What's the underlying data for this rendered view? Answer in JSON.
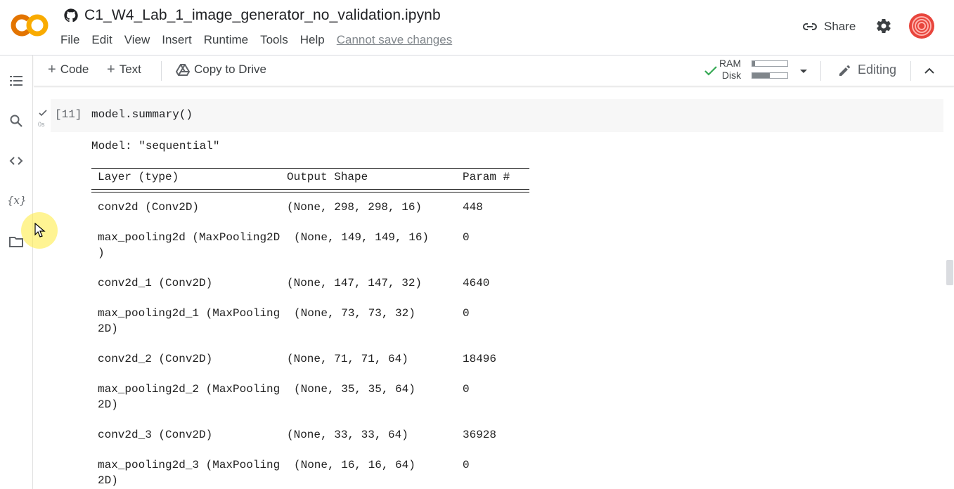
{
  "header": {
    "notebook_title": "C1_W4_Lab_1_image_generator_no_validation.ipynb",
    "logo_text": "CO",
    "menu": [
      "File",
      "Edit",
      "View",
      "Insert",
      "Runtime",
      "Tools",
      "Help"
    ],
    "save_status": "Cannot save changes",
    "share_label": "Share"
  },
  "toolbar": {
    "code_label": "Code",
    "text_label": "Text",
    "copy_drive_label": "Copy to Drive",
    "ram_label": "RAM",
    "disk_label": "Disk",
    "ram_usage": 0.08,
    "disk_usage": 0.5,
    "editing_label": "Editing"
  },
  "cell": {
    "exec_count": "[11]",
    "code": "model.summary()",
    "time": "0s"
  },
  "output": {
    "model_line": "Model: \"sequential\"",
    "headers": {
      "layer": "Layer (type)",
      "shape": "Output Shape",
      "params": "Param #"
    },
    "rows": [
      {
        "layer": "conv2d (Conv2D)",
        "layer2": "",
        "shape": "(None, 298, 298, 16)",
        "params": "448"
      },
      {
        "layer": "max_pooling2d (MaxPooling2D",
        "layer2": ")",
        "shape": "(None, 149, 149, 16)",
        "params": "0"
      },
      {
        "layer": "conv2d_1 (Conv2D)",
        "layer2": "",
        "shape": "(None, 147, 147, 32)",
        "params": "4640"
      },
      {
        "layer": "max_pooling2d_1 (MaxPooling",
        "layer2": "2D)",
        "shape": "(None, 73, 73, 32)",
        "params": "0"
      },
      {
        "layer": "conv2d_2 (Conv2D)",
        "layer2": "",
        "shape": "(None, 71, 71, 64)",
        "params": "18496"
      },
      {
        "layer": "max_pooling2d_2 (MaxPooling",
        "layer2": "2D)",
        "shape": "(None, 35, 35, 64)",
        "params": "0"
      },
      {
        "layer": "conv2d_3 (Conv2D)",
        "layer2": "",
        "shape": "(None, 33, 33, 64)",
        "params": "36928"
      },
      {
        "layer": "max_pooling2d_3 (MaxPooling",
        "layer2": "2D)",
        "shape": "(None, 16, 16, 64)",
        "params": "0"
      }
    ]
  },
  "colors": {
    "logo_orange": "#F9AB00",
    "logo_dark_orange": "#E37400",
    "avatar_red": "#E8453C"
  },
  "icons": [
    "github-icon",
    "link-icon",
    "gear-icon",
    "avatar-icon",
    "drive-icon",
    "check-icon",
    "chevron-down-icon",
    "pencil-icon",
    "chevron-up-icon",
    "toc-icon",
    "search-icon",
    "code-snippets-icon",
    "variables-icon",
    "folder-icon"
  ]
}
